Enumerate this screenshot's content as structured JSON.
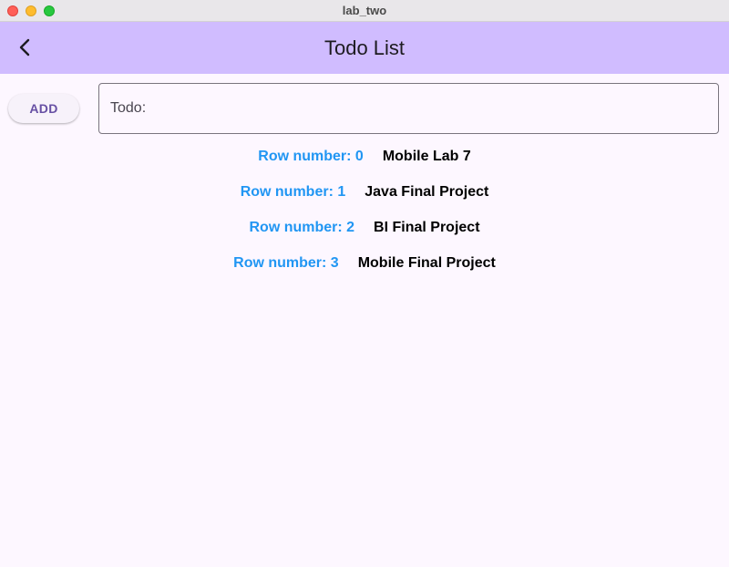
{
  "window": {
    "title": "lab_two"
  },
  "appbar": {
    "title": "Todo List",
    "back_icon": "chevron-left-icon"
  },
  "form": {
    "add_label": "ADD",
    "input_placeholder": "Todo:",
    "input_value": ""
  },
  "rows": [
    {
      "label": "Row number: 0",
      "text": "Mobile Lab 7"
    },
    {
      "label": "Row number: 1",
      "text": "Java Final Project"
    },
    {
      "label": "Row number: 2",
      "text": "BI Final Project"
    },
    {
      "label": "Row number: 3",
      "text": "Mobile Final Project"
    }
  ],
  "colors": {
    "appbar": "#d0bcff",
    "background": "#fdf7ff",
    "row_label": "#2196f3",
    "button_text": "#6750a4"
  }
}
